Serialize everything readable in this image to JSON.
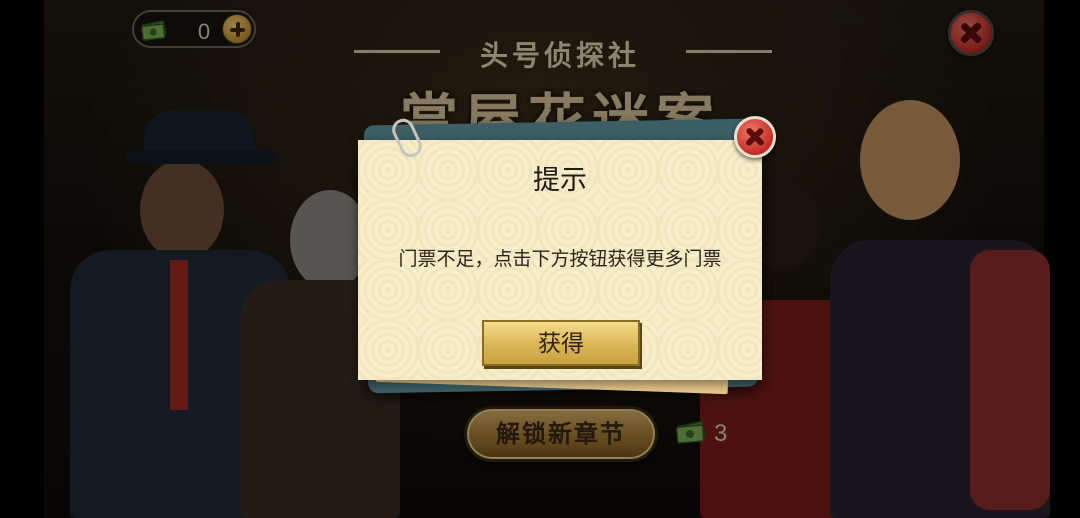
{
  "header": {
    "currency": {
      "icon": "cash-icon",
      "value": "0",
      "add_icon": "plus-icon"
    },
    "close_icon": "close-icon",
    "title_sub": "头号侦探社",
    "title_main": "赏屋花迷案"
  },
  "footer": {
    "unlock_label": "解锁新章节",
    "cost_icon": "cash-icon",
    "cost_value": "3"
  },
  "dialog": {
    "title": "提示",
    "message": "门票不足，点击下方按钮获得更多门票",
    "get_label": "获得",
    "close_icon": "close-icon"
  },
  "colors": {
    "dialog_paper": "#f8edcb",
    "dialog_frame": "#3c5e66",
    "button_gold": "#dbb655",
    "close_red": "#c9302a"
  }
}
